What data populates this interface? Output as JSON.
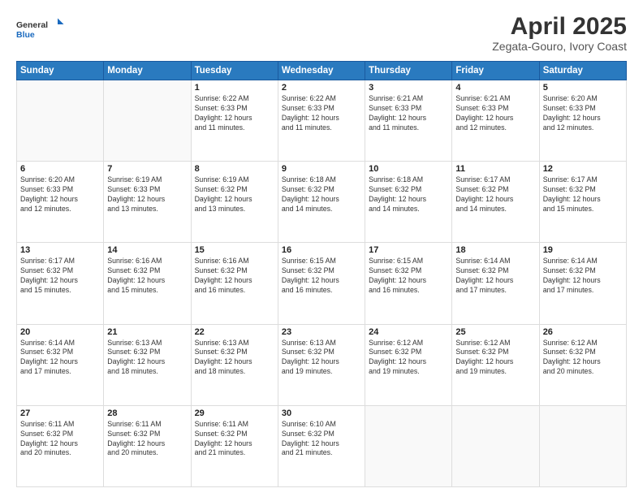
{
  "header": {
    "logo_general": "General",
    "logo_blue": "Blue",
    "title": "April 2025",
    "subtitle": "Zegata-Gouro, Ivory Coast"
  },
  "weekdays": [
    "Sunday",
    "Monday",
    "Tuesday",
    "Wednesday",
    "Thursday",
    "Friday",
    "Saturday"
  ],
  "weeks": [
    [
      {
        "day": "",
        "info": ""
      },
      {
        "day": "",
        "info": ""
      },
      {
        "day": "1",
        "info": "Sunrise: 6:22 AM\nSunset: 6:33 PM\nDaylight: 12 hours\nand 11 minutes."
      },
      {
        "day": "2",
        "info": "Sunrise: 6:22 AM\nSunset: 6:33 PM\nDaylight: 12 hours\nand 11 minutes."
      },
      {
        "day": "3",
        "info": "Sunrise: 6:21 AM\nSunset: 6:33 PM\nDaylight: 12 hours\nand 11 minutes."
      },
      {
        "day": "4",
        "info": "Sunrise: 6:21 AM\nSunset: 6:33 PM\nDaylight: 12 hours\nand 12 minutes."
      },
      {
        "day": "5",
        "info": "Sunrise: 6:20 AM\nSunset: 6:33 PM\nDaylight: 12 hours\nand 12 minutes."
      }
    ],
    [
      {
        "day": "6",
        "info": "Sunrise: 6:20 AM\nSunset: 6:33 PM\nDaylight: 12 hours\nand 12 minutes."
      },
      {
        "day": "7",
        "info": "Sunrise: 6:19 AM\nSunset: 6:33 PM\nDaylight: 12 hours\nand 13 minutes."
      },
      {
        "day": "8",
        "info": "Sunrise: 6:19 AM\nSunset: 6:32 PM\nDaylight: 12 hours\nand 13 minutes."
      },
      {
        "day": "9",
        "info": "Sunrise: 6:18 AM\nSunset: 6:32 PM\nDaylight: 12 hours\nand 14 minutes."
      },
      {
        "day": "10",
        "info": "Sunrise: 6:18 AM\nSunset: 6:32 PM\nDaylight: 12 hours\nand 14 minutes."
      },
      {
        "day": "11",
        "info": "Sunrise: 6:17 AM\nSunset: 6:32 PM\nDaylight: 12 hours\nand 14 minutes."
      },
      {
        "day": "12",
        "info": "Sunrise: 6:17 AM\nSunset: 6:32 PM\nDaylight: 12 hours\nand 15 minutes."
      }
    ],
    [
      {
        "day": "13",
        "info": "Sunrise: 6:17 AM\nSunset: 6:32 PM\nDaylight: 12 hours\nand 15 minutes."
      },
      {
        "day": "14",
        "info": "Sunrise: 6:16 AM\nSunset: 6:32 PM\nDaylight: 12 hours\nand 15 minutes."
      },
      {
        "day": "15",
        "info": "Sunrise: 6:16 AM\nSunset: 6:32 PM\nDaylight: 12 hours\nand 16 minutes."
      },
      {
        "day": "16",
        "info": "Sunrise: 6:15 AM\nSunset: 6:32 PM\nDaylight: 12 hours\nand 16 minutes."
      },
      {
        "day": "17",
        "info": "Sunrise: 6:15 AM\nSunset: 6:32 PM\nDaylight: 12 hours\nand 16 minutes."
      },
      {
        "day": "18",
        "info": "Sunrise: 6:14 AM\nSunset: 6:32 PM\nDaylight: 12 hours\nand 17 minutes."
      },
      {
        "day": "19",
        "info": "Sunrise: 6:14 AM\nSunset: 6:32 PM\nDaylight: 12 hours\nand 17 minutes."
      }
    ],
    [
      {
        "day": "20",
        "info": "Sunrise: 6:14 AM\nSunset: 6:32 PM\nDaylight: 12 hours\nand 17 minutes."
      },
      {
        "day": "21",
        "info": "Sunrise: 6:13 AM\nSunset: 6:32 PM\nDaylight: 12 hours\nand 18 minutes."
      },
      {
        "day": "22",
        "info": "Sunrise: 6:13 AM\nSunset: 6:32 PM\nDaylight: 12 hours\nand 18 minutes."
      },
      {
        "day": "23",
        "info": "Sunrise: 6:13 AM\nSunset: 6:32 PM\nDaylight: 12 hours\nand 19 minutes."
      },
      {
        "day": "24",
        "info": "Sunrise: 6:12 AM\nSunset: 6:32 PM\nDaylight: 12 hours\nand 19 minutes."
      },
      {
        "day": "25",
        "info": "Sunrise: 6:12 AM\nSunset: 6:32 PM\nDaylight: 12 hours\nand 19 minutes."
      },
      {
        "day": "26",
        "info": "Sunrise: 6:12 AM\nSunset: 6:32 PM\nDaylight: 12 hours\nand 20 minutes."
      }
    ],
    [
      {
        "day": "27",
        "info": "Sunrise: 6:11 AM\nSunset: 6:32 PM\nDaylight: 12 hours\nand 20 minutes."
      },
      {
        "day": "28",
        "info": "Sunrise: 6:11 AM\nSunset: 6:32 PM\nDaylight: 12 hours\nand 20 minutes."
      },
      {
        "day": "29",
        "info": "Sunrise: 6:11 AM\nSunset: 6:32 PM\nDaylight: 12 hours\nand 21 minutes."
      },
      {
        "day": "30",
        "info": "Sunrise: 6:10 AM\nSunset: 6:32 PM\nDaylight: 12 hours\nand 21 minutes."
      },
      {
        "day": "",
        "info": ""
      },
      {
        "day": "",
        "info": ""
      },
      {
        "day": "",
        "info": ""
      }
    ]
  ]
}
